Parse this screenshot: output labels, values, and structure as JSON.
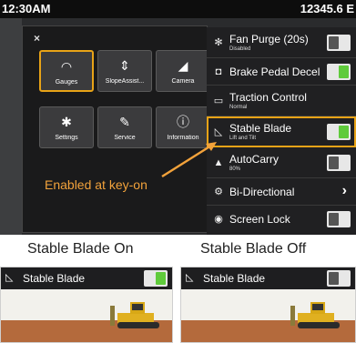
{
  "status_bar": {
    "time": "12:30AM",
    "hours": "12345.6 E"
  },
  "menu": {
    "close_glyph": "×",
    "tiles": [
      {
        "label": "Gauges",
        "icon": "gauge-icon",
        "glyph": "◠"
      },
      {
        "label": "SlopeAssist...",
        "icon": "slope-assist-icon",
        "glyph": "⇕"
      },
      {
        "label": "Camera",
        "icon": "camera-icon",
        "glyph": "◢"
      },
      {
        "label": "Settings",
        "icon": "gear-icon",
        "glyph": "✱"
      },
      {
        "label": "Service",
        "icon": "wrench-icon",
        "glyph": "✎"
      },
      {
        "label": "Information",
        "icon": "info-icon",
        "glyph": "ⓘ"
      }
    ]
  },
  "callout": {
    "text": "Enabled at key-on",
    "color": "#f2a23b"
  },
  "settings": [
    {
      "title": "Fan Purge (20s)",
      "subtitle": "Disabled",
      "icon": "fan-icon",
      "glyph": "✻",
      "control": "toggle",
      "state": "off"
    },
    {
      "title": "Brake Pedal Decel",
      "subtitle": "",
      "icon": "brake-icon",
      "glyph": "◘",
      "control": "toggle",
      "state": "on"
    },
    {
      "title": "Traction Control",
      "subtitle": "Normal",
      "icon": "traction-icon",
      "glyph": "▭",
      "control": "none",
      "state": ""
    },
    {
      "title": "Stable Blade",
      "subtitle": "Lift and Tilt",
      "icon": "stable-blade-icon",
      "glyph": "◺",
      "control": "toggle",
      "state": "on"
    },
    {
      "title": "AutoCarry",
      "subtitle": "80%",
      "icon": "autocarry-icon",
      "glyph": "▲",
      "control": "toggle",
      "state": "off"
    },
    {
      "title": "Bi-Directional",
      "subtitle": "",
      "icon": "bi-directional-icon",
      "glyph": "⚙",
      "control": "chevron",
      "state": ""
    },
    {
      "title": "Screen Lock",
      "subtitle": "",
      "icon": "screen-lock-icon",
      "glyph": "◉",
      "control": "toggle",
      "state": "off"
    }
  ],
  "comparison": {
    "left_label": "Stable Blade On",
    "right_label": "Stable Blade Off",
    "left": {
      "title": "Stable Blade",
      "state": "on"
    },
    "right": {
      "title": "Stable Blade",
      "state": "off"
    }
  },
  "colors": {
    "accent": "#e8a317",
    "toggle_on": "#5fcb3b",
    "toggle_off": "#555555",
    "soil": "#b46a3c"
  }
}
